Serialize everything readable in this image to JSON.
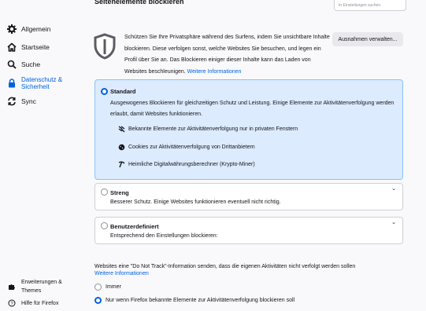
{
  "sidebar": {
    "items": [
      {
        "label": "Allgemein",
        "icon": "gear-icon"
      },
      {
        "label": "Startseite",
        "icon": "home-icon"
      },
      {
        "label": "Suche",
        "icon": "search-icon"
      },
      {
        "label": "Datenschutz & Sicherheit",
        "icon": "lock-icon",
        "active": true
      },
      {
        "label": "Sync",
        "icon": "sync-icon"
      }
    ],
    "bottom": [
      {
        "label": "Erweiterungen & Themes",
        "icon": "puzzle-icon"
      },
      {
        "label": "Hilfe für Firefox",
        "icon": "help-icon"
      }
    ]
  },
  "search": {
    "placeholder": "In Einstellungen suchen"
  },
  "section": {
    "title": "Seitenelemente blockieren"
  },
  "intro": {
    "text": "Schützen Sie Ihre Privatsphäre während des Surfens, indem Sie unsichtbare Inhalte blockieren. Diese verfolgen sonst, welche Websites Sie besuchen, und legen ein Profil über Sie an. Das Blockieren einiger dieser Inhalte kann das Laden von Websites beschleunigen.",
    "link": "Weitere Informationen",
    "exceptions_button": "Ausnahmen verwalten..."
  },
  "options": {
    "standard": {
      "title": "Standard",
      "desc": "Ausgewogenes Blockieren für gleichzeitigen Schutz und Leistung. Einige Elemente zur Aktivitätenverfolgung werden erlaubt, damit Websites funktionieren.",
      "features": [
        "Bekannte Elemente zur Aktivitätenverfolgung nur in privaten Fenstern",
        "Cookies zur Aktivitätenverfolgung von Drittanbietern",
        "Heimliche Digitalwährungsberechner (Krypto-Miner)"
      ]
    },
    "strict": {
      "title": "Streng",
      "desc": "Besserer Schutz. Einige Websites funktionieren eventuell nicht richtig."
    },
    "custom": {
      "title": "Benutzerdefiniert",
      "desc": "Entsprechend den Einstellungen blockieren:"
    }
  },
  "dnt": {
    "text": "Websites eine \"Do Not Track\"-Information senden, dass die eigenen Aktivitäten nicht verfolgt werden sollen",
    "link": "Weitere Informationen",
    "always": "Immer",
    "only_when": "Nur wenn Firefox bekannte Elemente zur Aktivitätenverfolgung blockieren soll"
  },
  "colors": {
    "accent": "#0061e0",
    "selected_bg": "#dcebfd"
  }
}
